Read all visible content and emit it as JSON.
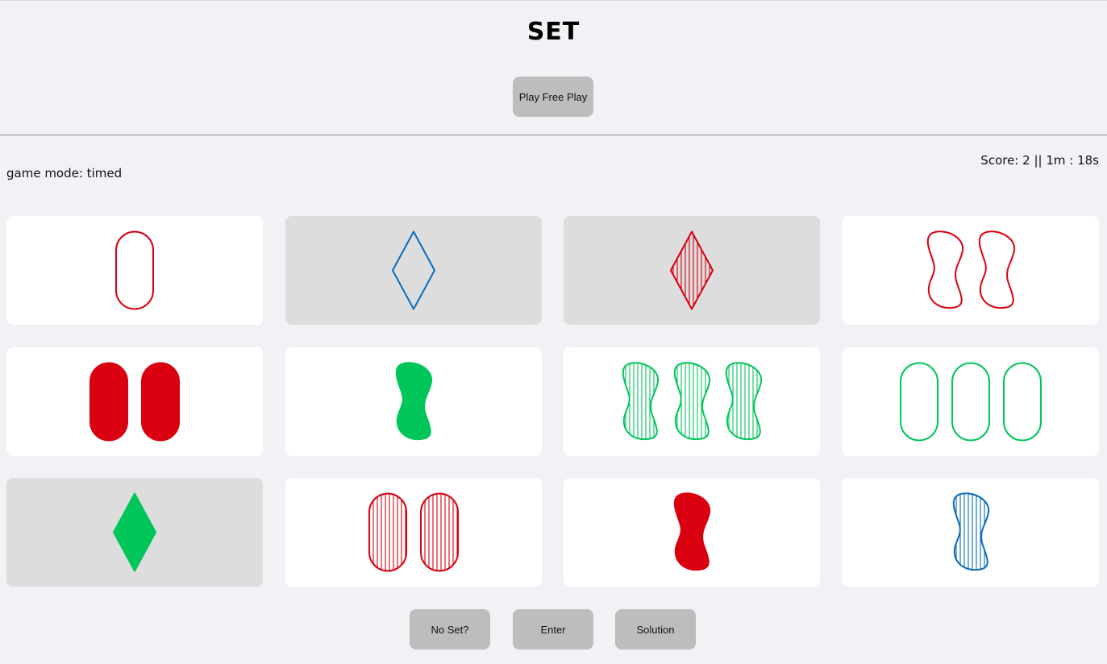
{
  "header": {
    "title": "SET",
    "play_button": "Play Free Play"
  },
  "status": {
    "mode_label": "game mode: timed",
    "score_label": "Score: 2",
    "separator": " || ",
    "timer": "1m : 18s"
  },
  "colors": {
    "red": "#d9000f",
    "blue": "#0a6bbd",
    "green": "#00c65a",
    "card_bg": "#ffffff",
    "card_selected_bg": "#dddddd",
    "button_bg": "#bdbdbd"
  },
  "cards": [
    {
      "count": 1,
      "shape": "oval",
      "color": "red",
      "fill": "empty",
      "selected": false
    },
    {
      "count": 1,
      "shape": "diamond",
      "color": "blue",
      "fill": "empty",
      "selected": true
    },
    {
      "count": 1,
      "shape": "diamond",
      "color": "red",
      "fill": "striped",
      "selected": true
    },
    {
      "count": 2,
      "shape": "squiggle",
      "color": "red",
      "fill": "empty",
      "selected": false
    },
    {
      "count": 2,
      "shape": "oval",
      "color": "red",
      "fill": "solid",
      "selected": false
    },
    {
      "count": 1,
      "shape": "squiggle",
      "color": "green",
      "fill": "solid",
      "selected": false
    },
    {
      "count": 3,
      "shape": "squiggle",
      "color": "green",
      "fill": "striped",
      "selected": false
    },
    {
      "count": 3,
      "shape": "oval",
      "color": "green",
      "fill": "empty",
      "selected": false
    },
    {
      "count": 1,
      "shape": "diamond",
      "color": "green",
      "fill": "solid",
      "selected": true
    },
    {
      "count": 2,
      "shape": "oval",
      "color": "red",
      "fill": "striped",
      "selected": false
    },
    {
      "count": 1,
      "shape": "squiggle",
      "color": "red",
      "fill": "solid",
      "selected": false
    },
    {
      "count": 1,
      "shape": "squiggle",
      "color": "blue",
      "fill": "striped",
      "selected": false
    }
  ],
  "controls": {
    "no_set": "No Set?",
    "enter": "Enter",
    "solution": "Solution"
  }
}
